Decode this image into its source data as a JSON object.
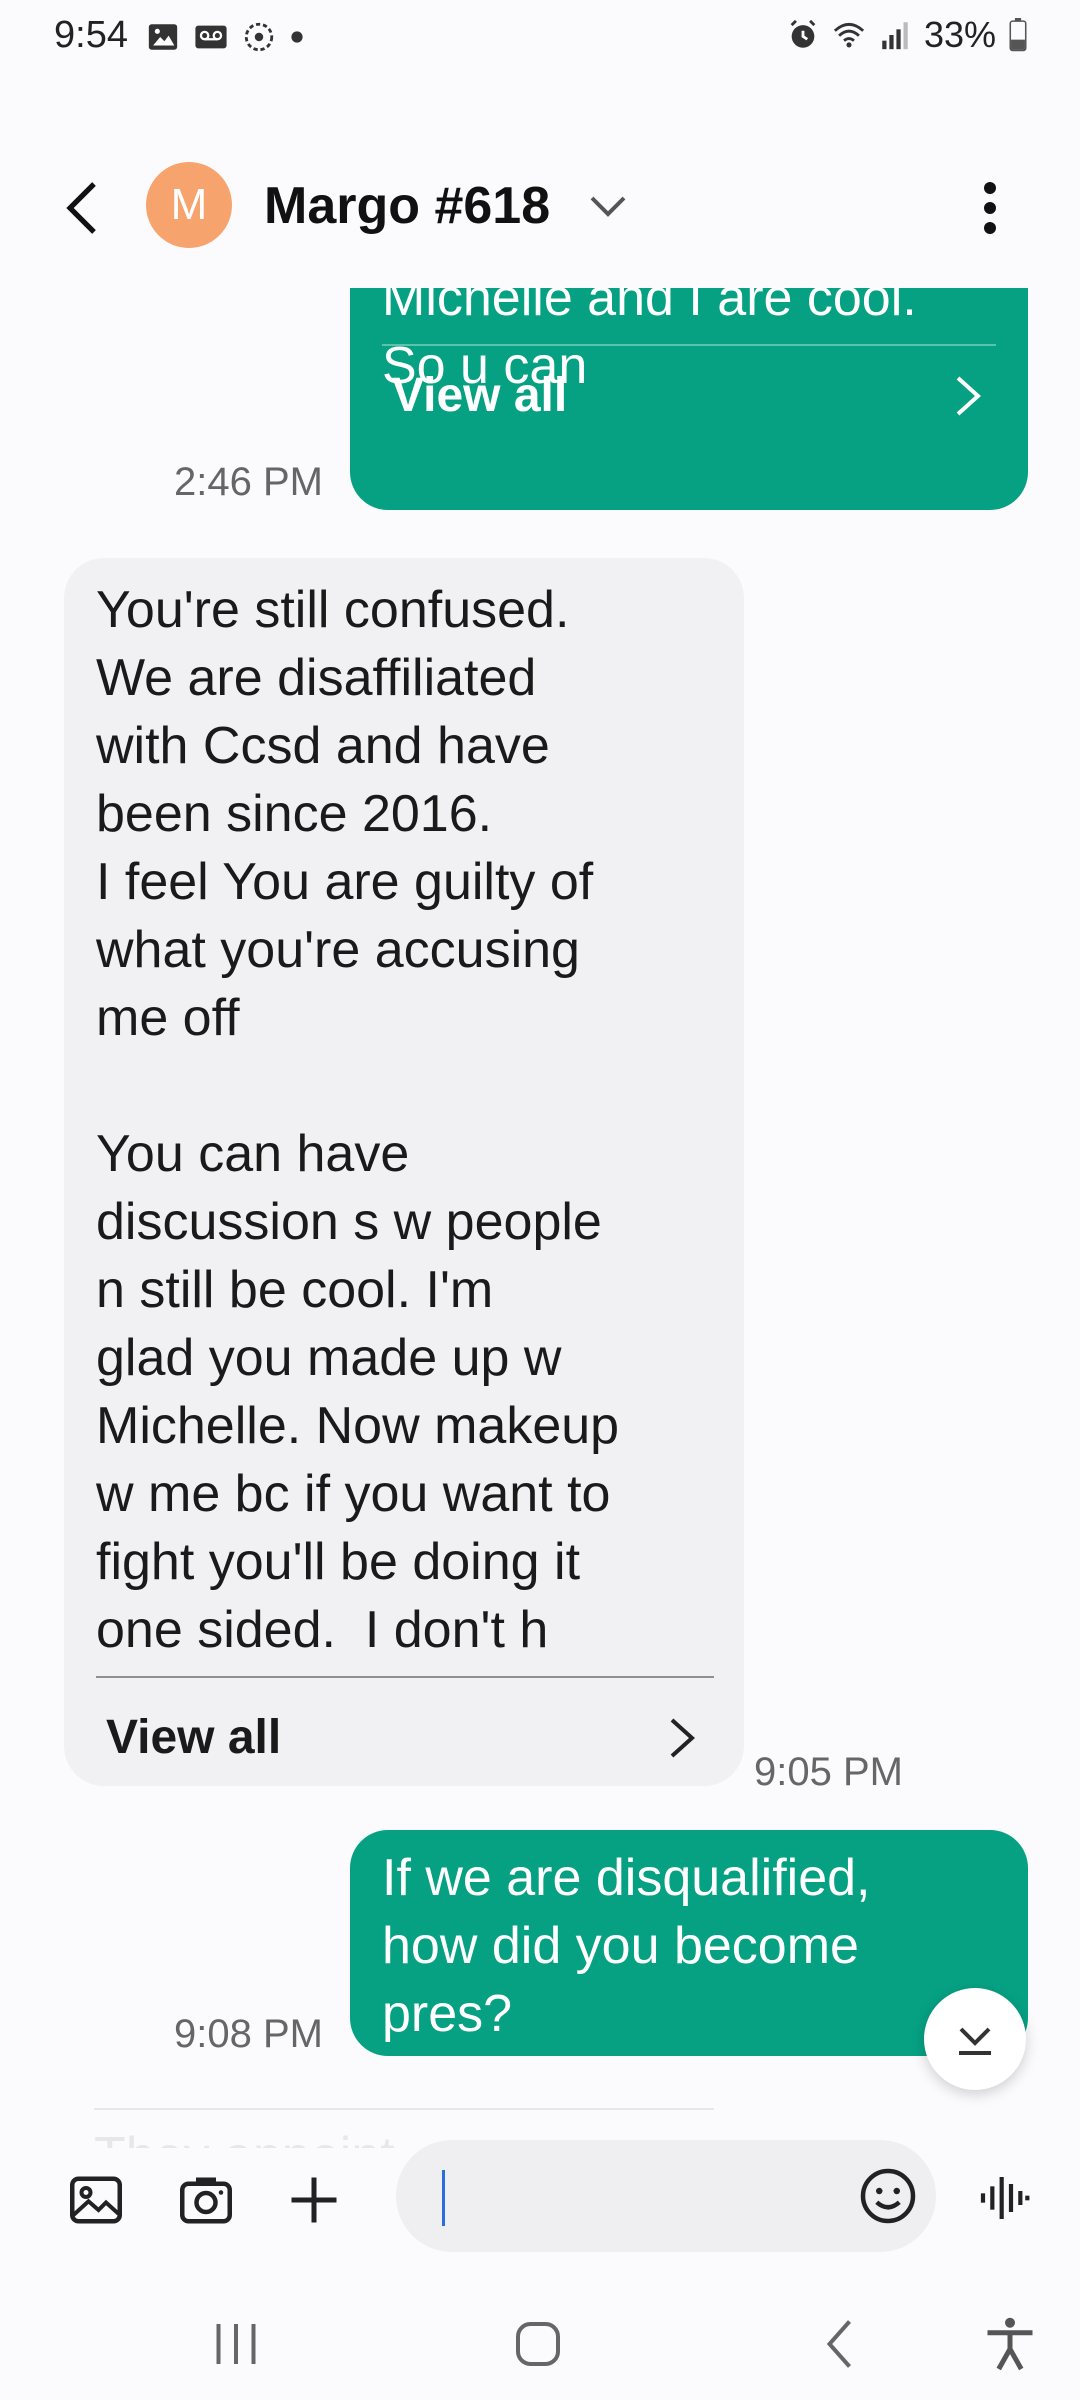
{
  "status_bar": {
    "time": "9:54",
    "battery": "33%",
    "left_icons": [
      "image-notification-icon",
      "voicemail-icon",
      "sync-icon",
      "dot-icon"
    ],
    "right_icons": [
      "alarm-icon",
      "wifi-icon",
      "signal-icon",
      "battery-icon"
    ]
  },
  "header": {
    "avatar_letter": "M",
    "avatar_color": "#f7a36d",
    "contact_name": "Margo #618"
  },
  "messages": [
    {
      "direction": "outgoing",
      "text": "Michelle and I are cool.\nSo u can",
      "view_all": "View all",
      "time": "2:46 PM"
    },
    {
      "direction": "incoming",
      "text": "You're still confused.\nWe are disaffiliated\nwith Ccsd and have\nbeen since 2016.\nI feel You are guilty of\nwhat you're accusing\nme off\n\nYou can have\ndiscussion s w people\nn still be cool. I'm\nglad you made up w\nMichelle. Now makeup\nw me bc if you want to\nfight you'll be doing it\none sided.  I don't h",
      "view_all": "View all",
      "time": "9:05 PM"
    },
    {
      "direction": "outgoing",
      "text": "If we are disqualified,\nhow did you become\npres?",
      "time": "9:08 PM"
    }
  ],
  "next_message_preview": "They appoint\nwas waiting to see wh",
  "composer": {
    "input_value": "",
    "input_placeholder": ""
  },
  "colors": {
    "outgoing_bubble": "#06a183",
    "incoming_bubble": "#f1f1f3",
    "background": "#fbfbfd"
  }
}
